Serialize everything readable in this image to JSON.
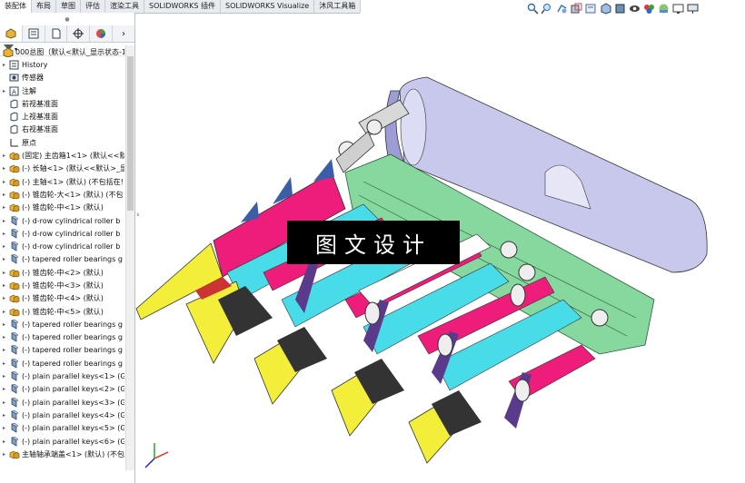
{
  "command_tabs": [
    "装配体",
    "布局",
    "草图",
    "评估",
    "渲染工具",
    "SOLIDWORKS 插件",
    "SOLIDWORKS Visualize",
    "沐风工具箱"
  ],
  "active_tab_index": 0,
  "view_tools": [
    "zoom-to-fit-icon",
    "zoom-area-icon",
    "previous-view-icon",
    "section-view-icon",
    "dynamic-annotation-icon",
    "view-orientation-icon",
    "display-style-icon",
    "hide-show-icon",
    "edit-appearance-icon",
    "apply-scene-icon",
    "view-settings-icon",
    "monitor-icon"
  ],
  "panel_tabs": [
    "feature-manager-icon",
    "property-manager-icon",
    "configuration-manager-icon",
    "dimxpert-icon",
    "display-manager-icon"
  ],
  "tree": {
    "root": "000总图（默认<默认_显示状态-1>）",
    "items": [
      {
        "label": "History",
        "arrow": "▸",
        "icon": "history-icon"
      },
      {
        "label": "传感器",
        "arrow": "",
        "icon": "sensor-icon"
      },
      {
        "label": "注解",
        "arrow": "▸",
        "icon": "annotation-icon"
      },
      {
        "label": "前视基准面",
        "arrow": "",
        "icon": "plane-icon"
      },
      {
        "label": "上视基准面",
        "arrow": "",
        "icon": "plane-icon"
      },
      {
        "label": "右视基准面",
        "arrow": "",
        "icon": "plane-icon"
      },
      {
        "label": "原点",
        "arrow": "",
        "icon": "origin-icon"
      },
      {
        "label": "(固定) 主齿箱1<1> (默认<<默",
        "arrow": "▸",
        "icon": "assembly-icon"
      },
      {
        "label": "(-) 长轴<1> (默认<<默认>_显",
        "arrow": "▸",
        "icon": "assembly-icon"
      },
      {
        "label": "(-) 主轴<1> (默认) (不包括在!",
        "arrow": "▸",
        "icon": "assembly-icon"
      },
      {
        "label": "(-) 锥齿轮-大<1> (默认) (不包",
        "arrow": "▸",
        "icon": "assembly-icon"
      },
      {
        "label": "(-) 锥齿轮-中<1> (默认)",
        "arrow": "▸",
        "icon": "assembly-icon"
      },
      {
        "label": "(-) d-row cylindrical roller b",
        "arrow": "▸",
        "icon": "part-icon"
      },
      {
        "label": "(-) d-row cylindrical roller b",
        "arrow": "▸",
        "icon": "part-icon"
      },
      {
        "label": "(-) d-row cylindrical roller b",
        "arrow": "▸",
        "icon": "part-icon"
      },
      {
        "label": "(-) tapered roller bearings g",
        "arrow": "▸",
        "icon": "part-icon"
      },
      {
        "label": "(-) 锥齿轮-中<2> (默认)",
        "arrow": "▸",
        "icon": "assembly-icon"
      },
      {
        "label": "(-) 锥齿轮-中<3> (默认)",
        "arrow": "▸",
        "icon": "assembly-icon"
      },
      {
        "label": "(-) 锥齿轮-中<4> (默认)",
        "arrow": "▸",
        "icon": "assembly-icon"
      },
      {
        "label": "(-) 锥齿轮-中<5> (默认)",
        "arrow": "▸",
        "icon": "assembly-icon"
      },
      {
        "label": "(-) tapered roller bearings g",
        "arrow": "▸",
        "icon": "part-icon"
      },
      {
        "label": "(-) tapered roller bearings g",
        "arrow": "▸",
        "icon": "part-icon"
      },
      {
        "label": "(-) tapered roller bearings g",
        "arrow": "▸",
        "icon": "part-icon"
      },
      {
        "label": "(-) tapered roller bearings g",
        "arrow": "▸",
        "icon": "part-icon"
      },
      {
        "label": "(-) plain parallel keys<1> (G",
        "arrow": "▸",
        "icon": "part-icon"
      },
      {
        "label": "(-) plain parallel keys<2> (G",
        "arrow": "▸",
        "icon": "part-icon"
      },
      {
        "label": "(-) plain parallel keys<3> (G",
        "arrow": "▸",
        "icon": "part-icon"
      },
      {
        "label": "(-) plain parallel keys<4> (G",
        "arrow": "▸",
        "icon": "part-icon"
      },
      {
        "label": "(-) plain parallel keys<5> (G",
        "arrow": "▸",
        "icon": "part-icon"
      },
      {
        "label": "(-) plain parallel keys<6> (G",
        "arrow": "▸",
        "icon": "part-icon"
      },
      {
        "label": "主轴轴承端盖<1> (默认) (不包",
        "arrow": "▸",
        "icon": "assembly-icon"
      }
    ]
  },
  "banner_text": "图文设计",
  "colors": {
    "tab_bg": "#e8ebef",
    "magenta": "#ee1c7a",
    "yellow": "#f2ee3a",
    "cyan": "#48dbe8",
    "housing": "#7ed69a",
    "cover": "#c9c9ec"
  }
}
